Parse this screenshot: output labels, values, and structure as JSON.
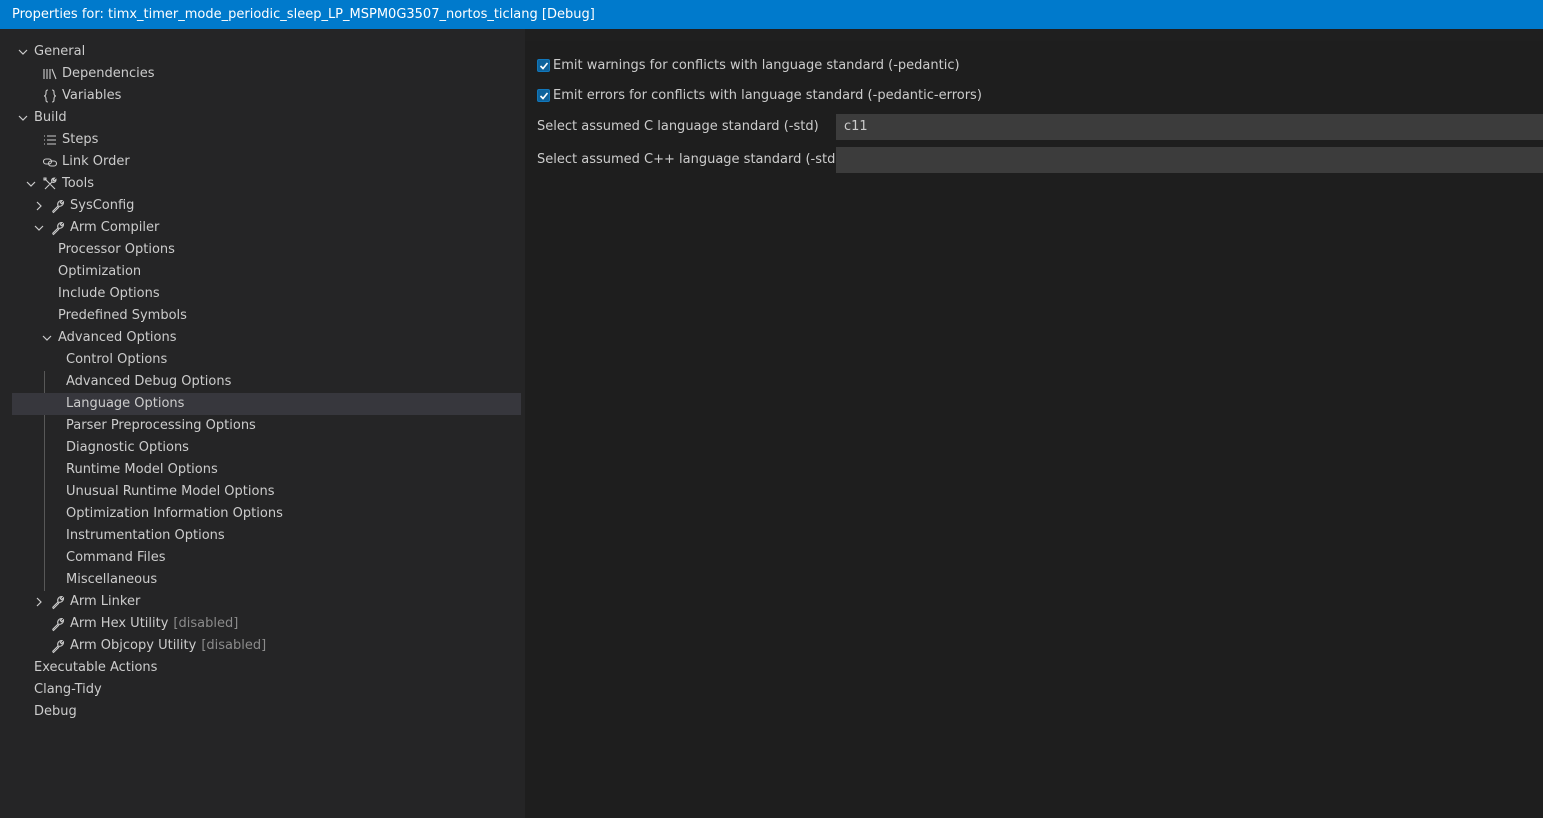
{
  "window": {
    "title": "Properties for: timx_timer_mode_periodic_sleep_LP_MSPM0G3507_nortos_ticlang [Debug]"
  },
  "tree": {
    "general": "General",
    "dependencies": "Dependencies",
    "variables": "Variables",
    "build": "Build",
    "steps": "Steps",
    "link_order": "Link Order",
    "tools": "Tools",
    "sysconfig": "SysConfig",
    "arm_compiler": "Arm Compiler",
    "processor_options": "Processor Options",
    "optimization": "Optimization",
    "include_options": "Include Options",
    "predefined_symbols": "Predefined Symbols",
    "advanced_options": "Advanced Options",
    "control_options": "Control Options",
    "advanced_debug_options": "Advanced Debug Options",
    "language_options": "Language Options",
    "parser_preprocessing_options": "Parser Preprocessing Options",
    "diagnostic_options": "Diagnostic Options",
    "runtime_model_options": "Runtime Model Options",
    "unusual_runtime_model_options": "Unusual Runtime Model Options",
    "optimization_information_options": "Optimization Information Options",
    "instrumentation_options": "Instrumentation Options",
    "command_files": "Command Files",
    "miscellaneous": "Miscellaneous",
    "arm_linker": "Arm Linker",
    "arm_hex_utility": "Arm Hex Utility",
    "arm_objcopy_utility": "Arm Objcopy Utility",
    "disabled_tag": "[disabled]",
    "executable_actions": "Executable Actions",
    "clang_tidy": "Clang-Tidy",
    "debug": "Debug"
  },
  "language_options": {
    "pedantic_label": "Emit warnings for conflicts with language standard (-pedantic)",
    "pedantic_checked": true,
    "pedantic_errors_label": "Emit errors for conflicts with language standard (-pedantic-errors)",
    "pedantic_errors_checked": true,
    "c_std_label": "Select assumed C language standard (-std)",
    "c_std_value": "c11",
    "cpp_std_label": "Select assumed C++ language standard (-std)",
    "cpp_std_value": ""
  },
  "colors": {
    "title_bar": "#007acc",
    "sidebar_bg": "#252526",
    "main_bg": "#1e1e1e",
    "selected_row": "#37373d",
    "checkbox": "#0e639c",
    "input_bg": "#3c3c3c",
    "disabled_text": "#8b8b8b"
  }
}
